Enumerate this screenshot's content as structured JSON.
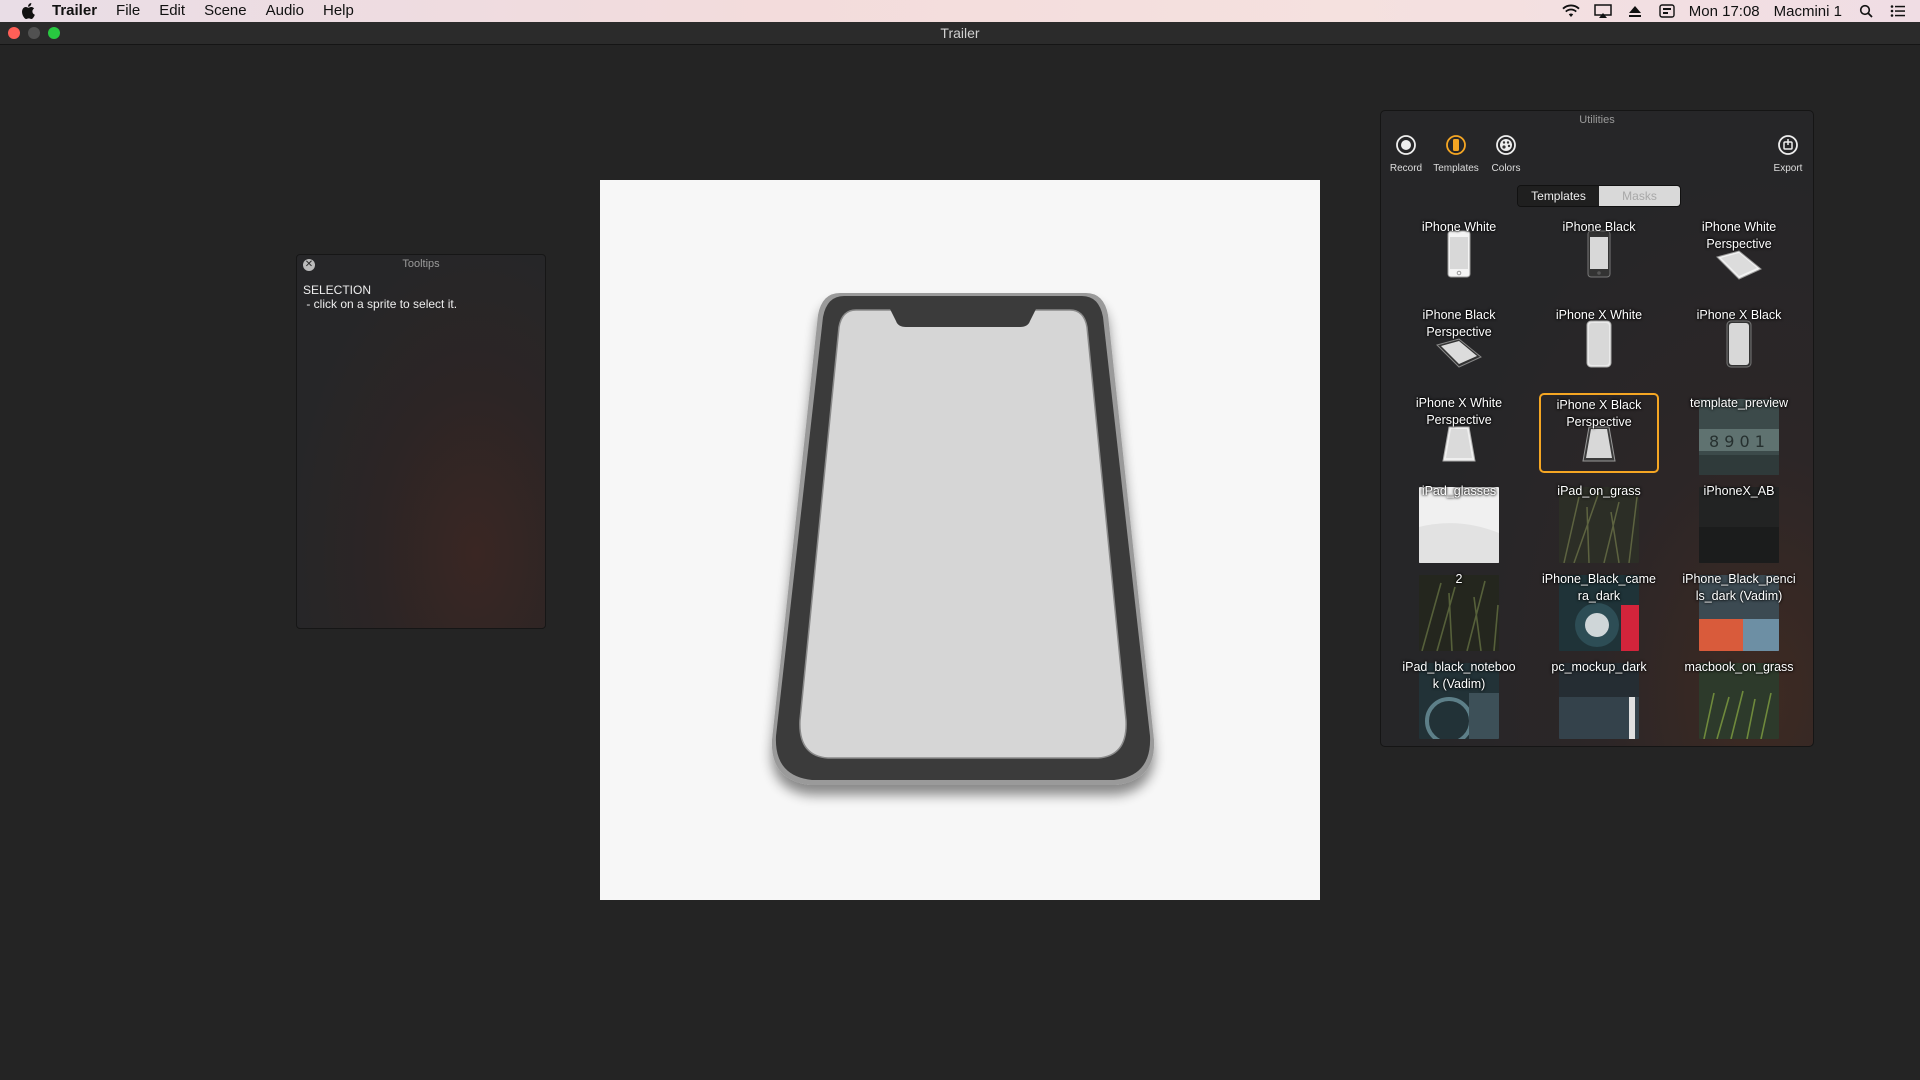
{
  "menubar": {
    "apple_icon": "apple-logo-icon",
    "app_name": "Trailer",
    "menus": [
      "File",
      "Edit",
      "Scene",
      "Audio",
      "Help"
    ],
    "status_icons": [
      "wifi-icon",
      "airplay-icon",
      "eject-icon",
      "keyboard-input-icon"
    ],
    "clock": "Mon 17:08",
    "user": "Macmini 1",
    "right_icons": [
      "spotlight-search-icon",
      "notification-center-icon"
    ]
  },
  "window": {
    "title": "Trailer"
  },
  "tooltips": {
    "title": "Tooltips",
    "heading": "SELECTION",
    "body": " - click on a sprite to select it."
  },
  "utilities": {
    "title": "Utilities",
    "tools": [
      {
        "label": "Record",
        "icon": "record-icon"
      },
      {
        "label": "Templates",
        "icon": "templates-icon",
        "active": true
      },
      {
        "label": "Colors",
        "icon": "palette-icon"
      }
    ],
    "export": {
      "label": "Export",
      "icon": "export-icon"
    },
    "tabs": {
      "templates": "Templates",
      "masks": "Masks"
    },
    "accent_color": "#f5a623",
    "templates": [
      {
        "label": "iPhone White"
      },
      {
        "label": "iPhone Black"
      },
      {
        "label": "iPhone White Perspective"
      },
      {
        "label": "iPhone Black Perspective"
      },
      {
        "label": "iPhone X White"
      },
      {
        "label": "iPhone X Black"
      },
      {
        "label": "iPhone X White Perspective"
      },
      {
        "label": "iPhone X Black Perspective",
        "selected": true
      },
      {
        "label": "template_preview"
      },
      {
        "label": "iPad_glasses"
      },
      {
        "label": "iPad_on_grass"
      },
      {
        "label": "iPhoneX_AB"
      },
      {
        "label": "2"
      },
      {
        "label": "iPhone_Black_camera_dark"
      },
      {
        "label": "iPhone_Black_pencils_dark (Vadim)"
      },
      {
        "label": "iPad_black_notebook (Vadim)"
      },
      {
        "label": "pc_mockup_dark"
      },
      {
        "label": "macbook_on_grass"
      }
    ]
  }
}
